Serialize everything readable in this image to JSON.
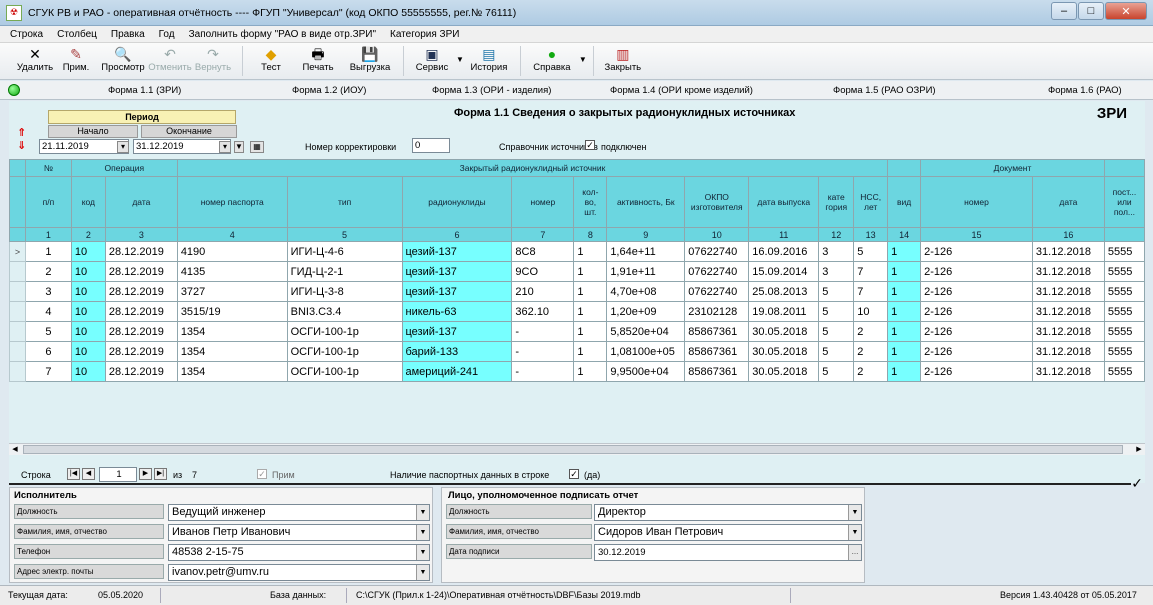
{
  "window": {
    "title": "СГУК РВ и РАО  -  оперативная отчётность  ----  ФГУП \"Универсал\"  (код ОКПО 55555555, рег.№ 76111)",
    "minimize": "–",
    "maximize": "□",
    "close": "✕"
  },
  "menu": [
    "Строка",
    "Столбец",
    "Правка",
    "Год",
    "Заполнить форму \"РАО в виде отр.ЗРИ\"",
    "Категория ЗРИ"
  ],
  "toolbar": {
    "delete": "Удалить",
    "note": "Прим.",
    "preview": "Просмотр",
    "undo": "Отменить",
    "redo": "Вернуть",
    "test": "Тест",
    "print": "Печать",
    "export": "Выгрузка",
    "service": "Сервис",
    "history": "История",
    "help": "Справка",
    "close": "Закрыть"
  },
  "form_tabs": [
    "Форма 1.1 (ЗРИ)",
    "Форма 1.2 (ИОУ)",
    "Форма 1.3 (ОРИ - изделия)",
    "Форма 1.4 (ОРИ кроме изделий)",
    "Форма 1.5 (РАО ОЗРИ)",
    "Форма 1.6 (РАО)"
  ],
  "period": {
    "title": "Период",
    "start_label": "Начало",
    "end_label": "Окончание",
    "start": "21.11.2019",
    "end": "31.12.2019"
  },
  "correction": {
    "label": "Номер корректировки",
    "value": "0"
  },
  "reference": {
    "label": "Справочник источников",
    "check_label": "подключен"
  },
  "form_title": "Форма 1.1 Сведения о закрытых радионуклидных источниках",
  "form_code": "ЗРИ",
  "grid": {
    "group_headers": {
      "num": "№",
      "operation": "Операция",
      "source": "Закрытый радионуклидный источник",
      "document": "Документ"
    },
    "columns": [
      "п/п",
      "код",
      "дата",
      "номер паспорта",
      "тип",
      "радионуклиды",
      "номер",
      "кол-во, шт.",
      "активность, Бк",
      "ОКПО изготовителя",
      "дата выпуска",
      "кате гория",
      "НСС, лет",
      "вид",
      "номер",
      "дата",
      "пост... или пол..."
    ],
    "col_numbers": [
      "1",
      "2",
      "3",
      "4",
      "5",
      "6",
      "7",
      "8",
      "9",
      "10",
      "11",
      "12",
      "13",
      "14",
      "15",
      "16",
      ""
    ],
    "rows": [
      [
        "1",
        "10",
        "28.12.2019",
        "4190",
        "ИГИ-Ц-4-6",
        "цезий-137",
        "8C8",
        "1",
        "1,64e+11",
        "07622740",
        "16.09.2016",
        "3",
        "5",
        "1",
        "2-126",
        "31.12.2018",
        "5555"
      ],
      [
        "2",
        "10",
        "28.12.2019",
        "4135",
        "ГИД-Ц-2-1",
        "цезий-137",
        "9CO",
        "1",
        "1,91e+11",
        "07622740",
        "15.09.2014",
        "3",
        "7",
        "1",
        "2-126",
        "31.12.2018",
        "5555"
      ],
      [
        "3",
        "10",
        "28.12.2019",
        "3727",
        "ИГИ-Ц-3-8",
        "цезий-137",
        "210",
        "1",
        "4,70e+08",
        "07622740",
        "25.08.2013",
        "5",
        "7",
        "1",
        "2-126",
        "31.12.2018",
        "5555"
      ],
      [
        "4",
        "10",
        "28.12.2019",
        "3515/19",
        "BNI3.C3.4",
        "никель-63",
        "362.10",
        "1",
        "1,20e+09",
        "23102128",
        "19.08.2011",
        "5",
        "10",
        "1",
        "2-126",
        "31.12.2018",
        "5555"
      ],
      [
        "5",
        "10",
        "28.12.2019",
        "1354",
        "ОСГИ-100-1р",
        "цезий-137",
        "-",
        "1",
        "5,8520e+04",
        "85867361",
        "30.05.2018",
        "5",
        "2",
        "1",
        "2-126",
        "31.12.2018",
        "5555"
      ],
      [
        "6",
        "10",
        "28.12.2019",
        "1354",
        "ОСГИ-100-1р",
        "барий-133",
        "-",
        "1",
        "1,08100e+05",
        "85867361",
        "30.05.2018",
        "5",
        "2",
        "1",
        "2-126",
        "31.12.2018",
        "5555"
      ],
      [
        "7",
        "10",
        "28.12.2019",
        "1354",
        "ОСГИ-100-1р",
        "америций-241",
        "-",
        "1",
        "9,9500e+04",
        "85867361",
        "30.05.2018",
        "5",
        "2",
        "1",
        "2-126",
        "31.12.2018",
        "5555"
      ]
    ],
    "current_marker": ">"
  },
  "nav": {
    "row_label": "Строка",
    "current": "1",
    "of_label": "из",
    "total": "7",
    "note_label": "Прим",
    "passport_label": "Наличие паспортных данных в строке",
    "passport_check": "(да)"
  },
  "executor": {
    "title": "Исполнитель",
    "position_label": "Должность",
    "position": "Ведущий инженер",
    "name_label": "Фамилия, имя, отчество",
    "name": "Иванов Петр Иванович",
    "phone_label": "Телефон",
    "phone": "48538 2-15-75",
    "email_label": "Адрес электр. почты",
    "email": "ivanov.petr@umv.ru"
  },
  "signer": {
    "title": "Лицо, уполномоченное подписать отчет",
    "position_label": "Должность",
    "position": "Директор",
    "name_label": "Фамилия, имя, отчество",
    "name": "Сидоров Иван Петрович",
    "date_label": "Дата подписи",
    "date": "30.12.2019"
  },
  "status": {
    "date_label": "Текущая дата:",
    "date": "05.05.2020",
    "db_label": "База данных:",
    "db_path": "C:\\СГУК (Прил.к 1-24)\\Оперативная отчётность\\DBF\\Базы 2019.mdb",
    "version": "Версия 1.43.40428 от 05.05.2017"
  }
}
